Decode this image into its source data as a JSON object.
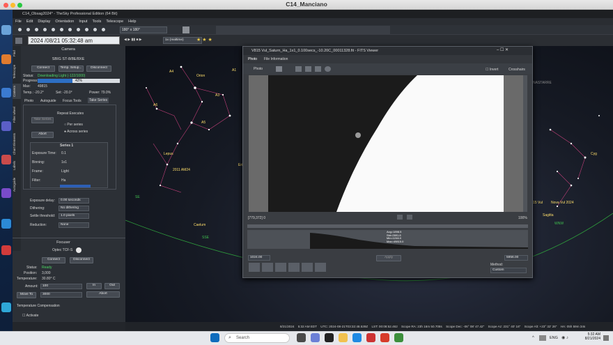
{
  "mac": {
    "title": "C14_Manciano"
  },
  "thesky": {
    "title": "C14_Obsag2024* - TheSky Professional Edition (64 Bit)",
    "menu": [
      "File",
      "Edit",
      "Display",
      "Orientation",
      "Input",
      "Tools",
      "Telescope",
      "Help"
    ],
    "fov": "180° x 180°",
    "date": "2024 /08/21 05:32:48 am",
    "location": "1x (realtime)"
  },
  "side_tabs": [
    "Find",
    "Telescope",
    "Camera",
    "Filter wheel",
    "Chart Elements",
    "Labels",
    "Autoguide"
  ],
  "camera": {
    "title": "Camera",
    "model": "SBIG ST-8/8E/8XE",
    "connect": "Connect",
    "temp_setup": "Temp. Setup...",
    "disconnect": "Disconnect",
    "status_label": "Status:",
    "status_value": "Downloading Light (-122/1000)",
    "progress_label": "Progress:",
    "progress_value": "42%",
    "progress": 0.42,
    "max_label": "Max:",
    "max_value": "49815",
    "temp_label": "Temp.: -20.2°",
    "set_label": "Set: -20.0°",
    "power_label": "Power: 79.0%",
    "subtabs": [
      "Photo",
      "Autoguide",
      "Focus Tools",
      "Take Series"
    ],
    "repeat_label": "Repeat Executes",
    "take_series": "Take Series",
    "abort": "Abort",
    "per_series": "Per series",
    "across_series": "Across series",
    "series_header": "Series 1",
    "rows": [
      {
        "k": "Exposure Time:",
        "v": "0.1"
      },
      {
        "k": "Binning:",
        "v": "1x1"
      },
      {
        "k": "Frame:",
        "v": "Light"
      },
      {
        "k": "Filter:",
        "v": "Ha"
      }
    ],
    "delay_label": "Exposure delay:",
    "delay_value": "0.00 seconds",
    "dither_label": "Dithering:",
    "dither_value": "No dithering",
    "settle_label": "Settle threshold:",
    "settle_value": "1.0 pixels",
    "reduction_label": "Reduction:",
    "reduction_value": "None"
  },
  "focuser": {
    "title": "Focuser",
    "model": "Optec TCF-S",
    "connect": "Connect",
    "disconnect": "Disconnect",
    "status_label": "Status:",
    "status_value": "Ready",
    "position_label": "Position:",
    "position_value": "3,000",
    "temperature_label": "Temperature:",
    "temperature_value": "30.80° C",
    "amount_label": "Amount:",
    "amount_value": "100",
    "in": "In",
    "out": "Out",
    "moveto": "Move To",
    "moveto_value": "3000",
    "abort": "Abort",
    "comp_title": "Temperature Compensation",
    "activate": "Activate"
  },
  "sky_labels": [
    "A4",
    "A1",
    "Orion",
    "A3",
    "A6",
    "A5",
    "Lepus",
    "2011 AM24",
    "Eri",
    "Caelum",
    "SE",
    "SSE",
    "Nova Vul 2024",
    "Sagitta",
    "15 Vul",
    "Cyg",
    "NASTARRE",
    "WNW",
    "SSW"
  ],
  "fits": {
    "title": "V815 Vul_Saturn_Ha_1x1_0.100secs_-10.20C_00011328.fit - FITS Viewer",
    "tabs": [
      "Photo",
      "File Information"
    ],
    "photo_dropdown": "Photo",
    "invert": "Invert",
    "crosshairs": "Crosshairs",
    "coords": "[779,372] 0",
    "zoom": "100%",
    "stats": [
      "Avg=1898.5",
      "Std=2691.8",
      "Min=1246.0",
      "Max=49815.0"
    ],
    "min_value": "1024.00",
    "max_value": "5956.00",
    "apply": "Apply",
    "method_label": "Method:",
    "method_value": "Custom"
  },
  "statusbar": {
    "date": "8/21/2024",
    "time": "5:32 AM EDT",
    "utc": "UTC: 2024-08-21T03:32:48.539Z",
    "lst": "LST: 00:08:52.462",
    "ra": "Scope RA: 23h 16m 50.708s",
    "dec": "Scope Dec: -06° 08' 47.42\"",
    "az": "Scope Az: 231° 40' 16\"",
    "alt": "Scope Alt: +23° 32' 26\"",
    "ha": "HA: 05h 59m 34s"
  },
  "taskbar": {
    "search": "Search",
    "lang": "ENG",
    "clock_time": "5:32 AM",
    "clock_date": "8/21/2024"
  },
  "colors": {
    "accent": "#2d6fc4",
    "ready": "#4cd964",
    "status": "#4cd964"
  }
}
